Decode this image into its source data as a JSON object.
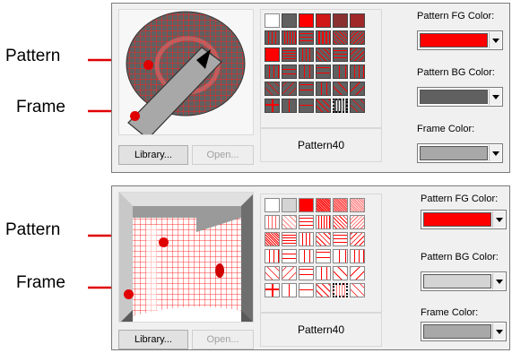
{
  "callouts": {
    "top_pattern": "Pattern",
    "top_frame": "Frame",
    "bottom_pattern": "Pattern",
    "bottom_frame": "Frame"
  },
  "panels": [
    {
      "library_label": "Library...",
      "open_label": "Open...",
      "pattern_name": "Pattern40",
      "fg_label": "Pattern FG Color:",
      "bg_label": "Pattern BG Color:",
      "frame_label": "Frame Color:",
      "fg_color": "#ff0000",
      "bg_color": "#606060",
      "frame_color": "#a8a8a8"
    },
    {
      "library_label": "Library...",
      "open_label": "Open...",
      "pattern_name": "Pattern40",
      "fg_label": "Pattern FG Color:",
      "bg_label": "Pattern BG Color:",
      "frame_label": "Frame Color:",
      "fg_color": "#ff0000",
      "bg_color": "#d4d4d4",
      "frame_color": "#a8a8a8"
    }
  ],
  "icons": {
    "dropdown": "chevron-down-icon",
    "callout_marker": "red-dot-marker"
  }
}
